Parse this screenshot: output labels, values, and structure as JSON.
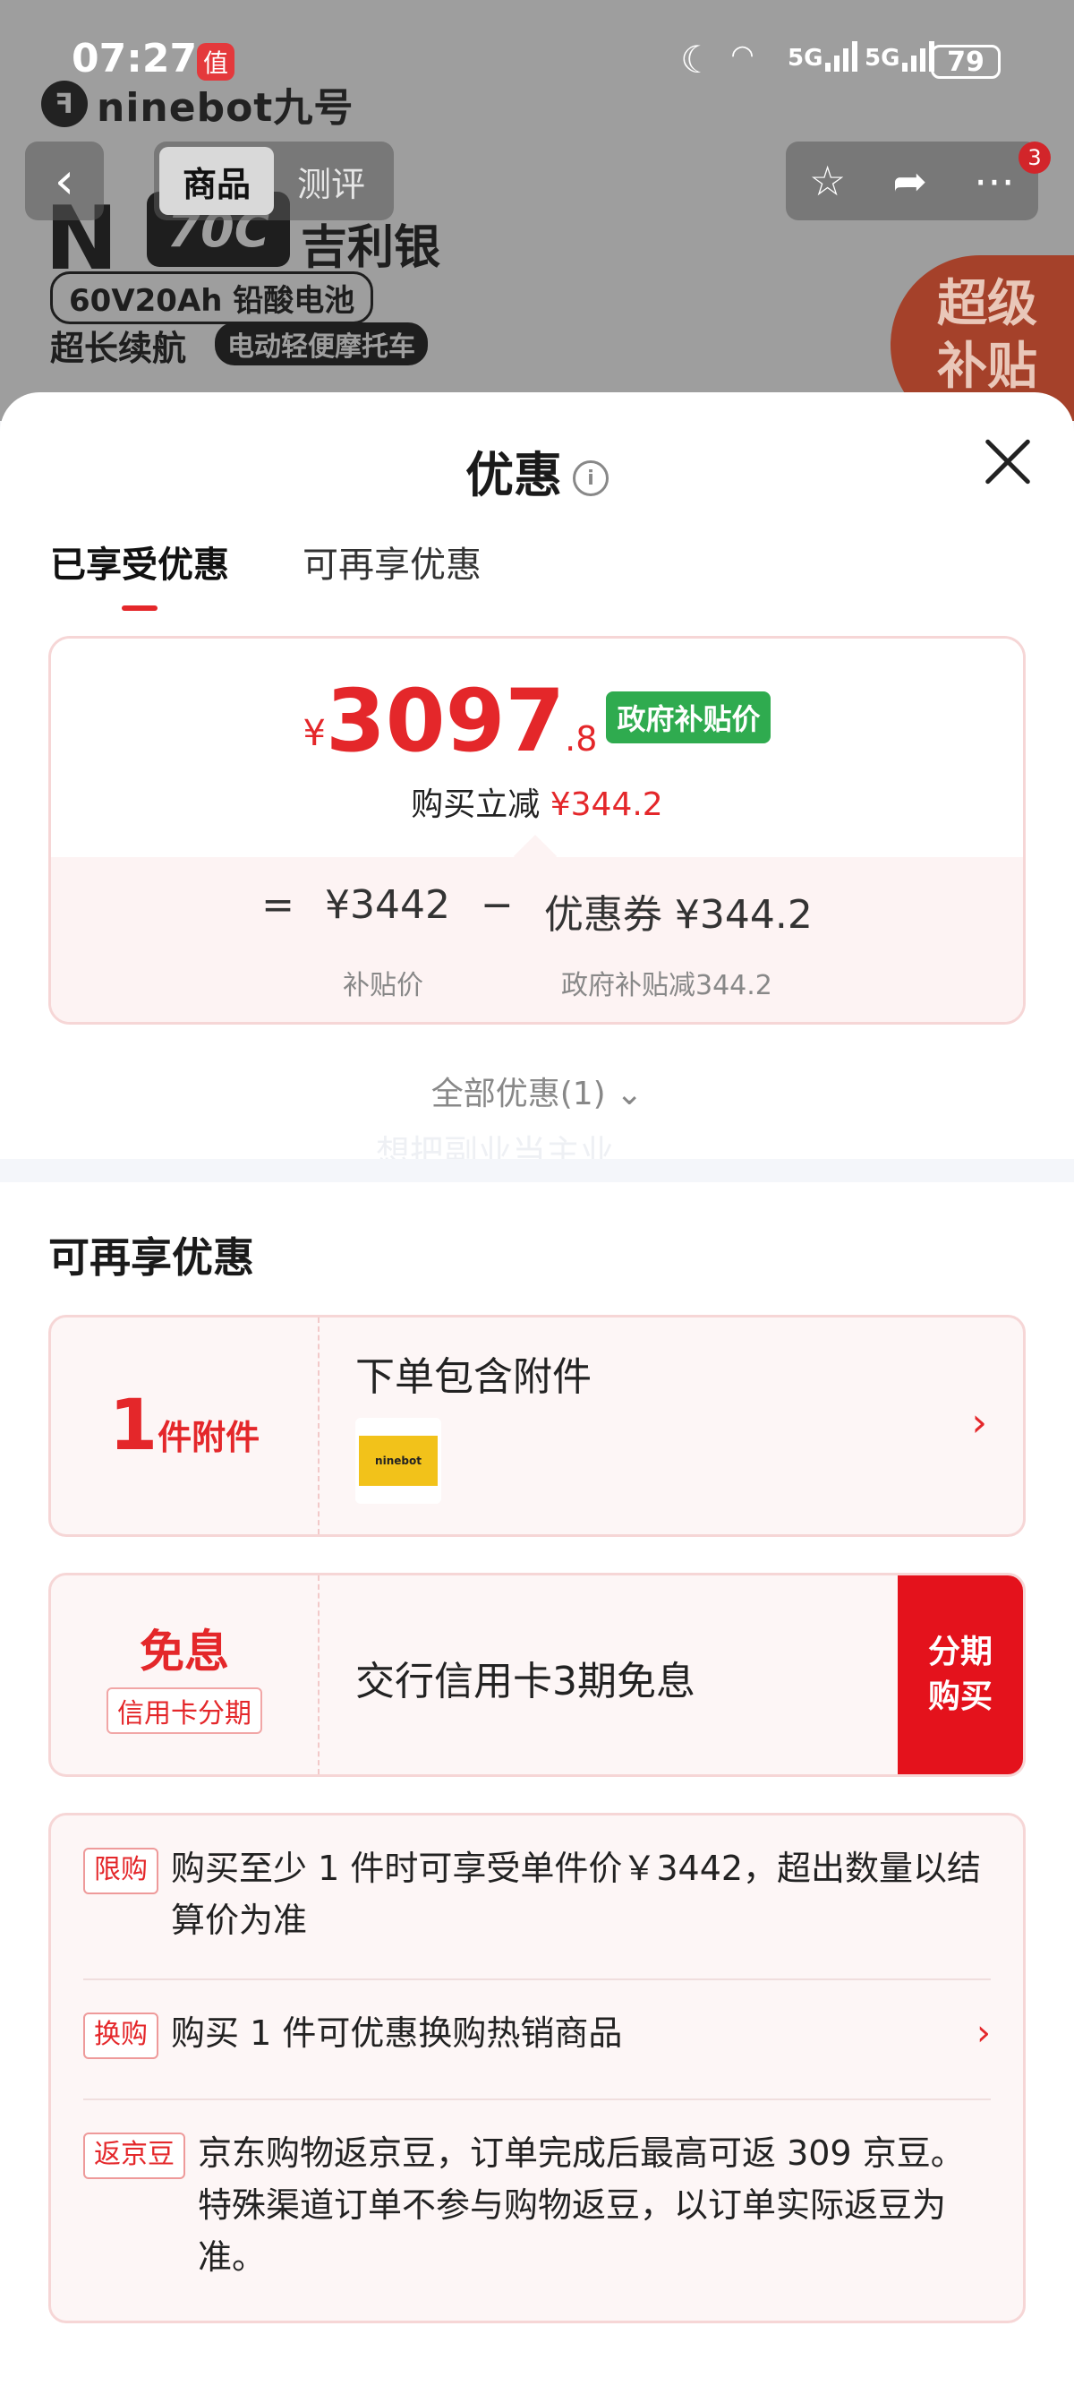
{
  "status_bar": {
    "time": "07:27",
    "app_badge": "值",
    "net1": "5G",
    "net2": "5G",
    "battery": "79"
  },
  "background": {
    "brand": "ninebot九号",
    "hero_letter": "N",
    "hero_model": "70C",
    "hero_color": "吉利银",
    "hero_battery": "60V20Ah 铅酸电池",
    "hero_range": "超长续航",
    "hero_tag": "电动轻便摩托车",
    "promo_line1": "超级",
    "promo_line2": "补贴",
    "tabs": [
      "商品",
      "测评"
    ],
    "cart_badge": "3"
  },
  "sheet": {
    "title": "优惠",
    "tabs": [
      {
        "label": "已享受优惠",
        "active": true
      },
      {
        "label": "可再享优惠",
        "active": false
      }
    ],
    "price": {
      "currency": "¥",
      "integer": "3097",
      "decimal": ".8",
      "badge": "政府补贴价",
      "reduce_label": "购买立减",
      "reduce_amount": "¥344.2"
    },
    "formula": {
      "equals": "=",
      "base": "¥3442",
      "minus": "−",
      "coupon": "优惠券 ¥344.2",
      "base_caption": "补贴价",
      "coupon_caption": "政府补贴减344.2"
    },
    "all_offers": "全部优惠(1)",
    "watermark": "想把副业当主业",
    "section_title": "可再享优惠",
    "accessory_card": {
      "qty": "1",
      "qty_unit": "件附件",
      "title": "下单包含附件",
      "thumb_label": "ninebot"
    },
    "installment_card": {
      "main": "免息",
      "tag": "信用卡分期",
      "text": "交行信用卡3期免息",
      "button_line1": "分期",
      "button_line2": "购买"
    },
    "rules": [
      {
        "tag": "限购",
        "text": "购买至少 1 件时可享受单件价￥3442，超出数量以结算价为准"
      },
      {
        "tag": "换购",
        "text": "购买 1 件可优惠换购热销商品"
      },
      {
        "tag": "返京豆",
        "text": "京东购物返京豆，订单完成后最高可返 309 京豆。特殊渠道订单不参与购物返豆，以订单实际返豆为准。"
      }
    ]
  }
}
